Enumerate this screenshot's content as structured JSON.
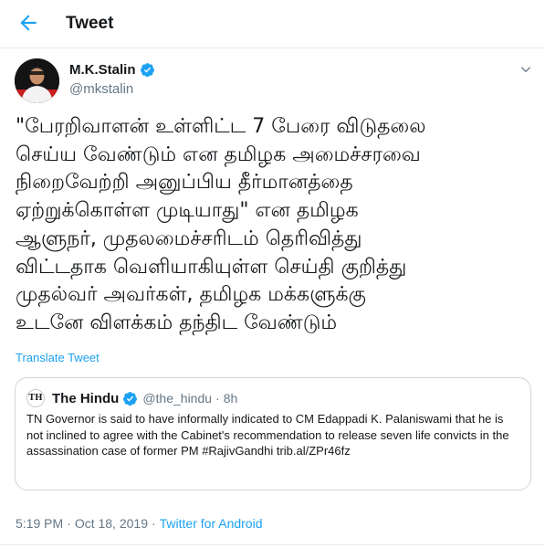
{
  "header": {
    "title": "Tweet",
    "back_icon": "arrow-left-icon"
  },
  "author": {
    "name": "M.K.Stalin",
    "handle": "@mkstalin",
    "verified_icon": "verified-badge-icon",
    "menu_icon": "chevron-down-icon"
  },
  "tweet": {
    "text": "\"பேரறிவாளன் உள்ளிட்ட 7 பேரை விடுதலை\nசெய்ய வேண்டும் என தமிழக அமைச்சரவை\nநிறைவேற்றி அனுப்பிய தீர்மானத்தை\nஏற்றுக்கொள்ள முடியாது\" என தமிழக\nஆளுநர், முதலமைச்சரிடம் தெரிவித்து\nவிட்டதாக வெளியாகியுள்ள செய்தி குறித்து\nமுதல்வர் அவர்கள், தமிழக மக்களுக்கு\nஉடனே விளக்கம் தந்திட வேண்டும்",
    "translate_label": "Translate Tweet"
  },
  "quote": {
    "logo_text": "TH",
    "name": "The Hindu",
    "verified_icon": "verified-badge-icon",
    "handle": "@the_hindu",
    "dot": "·",
    "time": "8h",
    "text": "TN Governor is said to have informally indicated to CM Edappadi K. Palaniswami that he is not inclined to agree with the Cabinet's recommendation to release seven life convicts in the assassination case of former PM #RajivGandhi trib.al/ZPr46fz"
  },
  "meta": {
    "time": "5:19 PM",
    "sep1": "·",
    "date": "Oct 18, 2019",
    "sep2": "·",
    "source": "Twitter for Android"
  },
  "colors": {
    "accent": "#1da1f2",
    "muted": "#657786",
    "border": "#ccd6dd"
  }
}
